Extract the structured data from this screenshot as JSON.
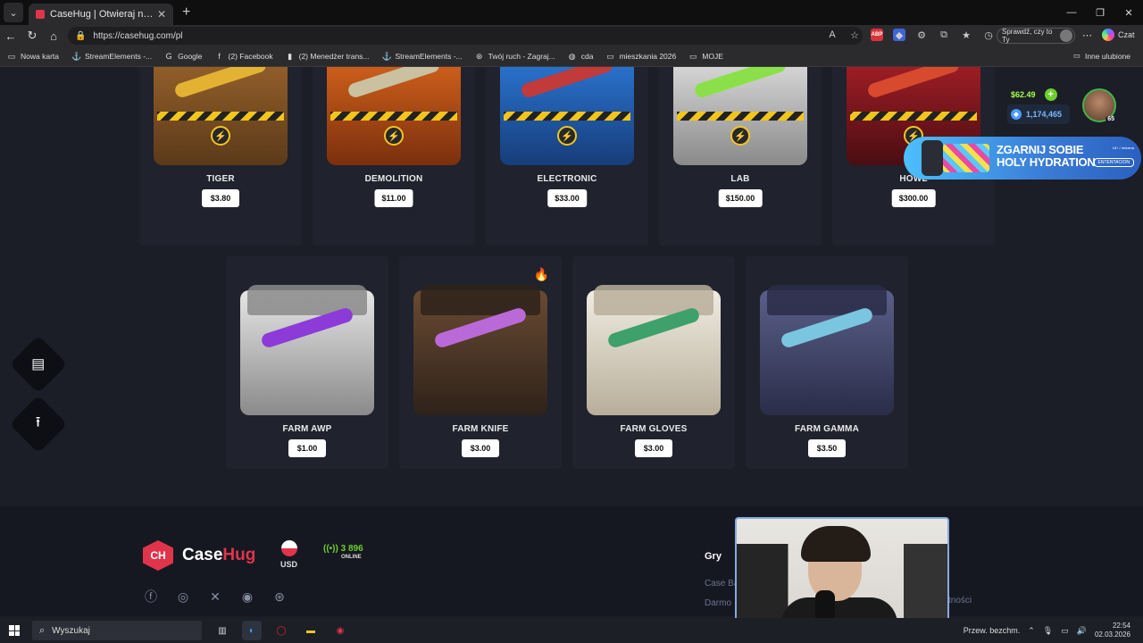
{
  "browser": {
    "tab_title": "CaseHug | Otwieraj najlepsze skrzy",
    "url": "https://casehug.com/pl",
    "profile_label": "Sprawdź, czy to Ty",
    "copilot_label": "Czat",
    "bookmarks": [
      {
        "label": "Nowa karta",
        "icon": "page-icon"
      },
      {
        "label": "StreamElements -...",
        "icon": "streamelements-icon"
      },
      {
        "label": "Google",
        "icon": "google-icon"
      },
      {
        "label": "(2) Facebook",
        "icon": "facebook-icon"
      },
      {
        "label": "(2) Menedżer trans...",
        "icon": "twitch-icon"
      },
      {
        "label": "StreamElements -...",
        "icon": "streamelements-icon"
      },
      {
        "label": "Twój ruch - Zagraj...",
        "icon": "steam-icon"
      },
      {
        "label": "cda",
        "icon": "globe-icon"
      },
      {
        "label": "mieszkania 2026",
        "icon": "folder-icon"
      },
      {
        "label": "MOJE",
        "icon": "folder-icon"
      }
    ],
    "other_favorites": "Inne ulubione"
  },
  "wallet": {
    "balance": "$62.49",
    "coins": "1,174,465",
    "level": "65"
  },
  "ad": {
    "headline_1": "ZGARNIJ SOBIE",
    "headline_2": "HOLY HYDRATION",
    "small": "18+ / reklama",
    "pill": "ENTENTACION"
  },
  "cases_row1": [
    {
      "name": "TIGER",
      "price": "$3.80",
      "color_a": "#a0672d",
      "color_b": "#5b3a1a",
      "item": "#e3b233"
    },
    {
      "name": "DEMOLITION",
      "price": "$11.00",
      "color_a": "#e26a1e",
      "color_b": "#7a2f0e",
      "item": "#c9c1a0"
    },
    {
      "name": "ELECTRONIC",
      "price": "$33.00",
      "color_a": "#2e7fe0",
      "color_b": "#173d7a",
      "item": "#c23a3a"
    },
    {
      "name": "LAB",
      "price": "$150.00",
      "color_a": "#e8e8e8",
      "color_b": "#8a8a8a",
      "item": "#8be04a"
    },
    {
      "name": "HOWL",
      "price": "$300.00",
      "color_a": "#b3212a",
      "color_b": "#4a0d12",
      "item": "#d84a2e"
    }
  ],
  "cases_row2": [
    {
      "name": "FARM AWP",
      "price": "$1.00",
      "color_a": "#e6e6e6",
      "color_b": "#8a8a8a",
      "item": "#8c3ad8"
    },
    {
      "name": "FARM KNIFE",
      "price": "$3.00",
      "color_a": "#6a4a32",
      "color_b": "#2e221a",
      "item": "#b96ad8",
      "hot": true
    },
    {
      "name": "FARM GLOVES",
      "price": "$3.00",
      "color_a": "#f0ece2",
      "color_b": "#b8ae9a",
      "item": "#3ea06a"
    },
    {
      "name": "FARM GAMMA",
      "price": "$3.50",
      "color_a": "#5a5f8a",
      "color_b": "#2a2d48",
      "item": "#7ac6e0"
    }
  ],
  "footer": {
    "brand_a": "Case",
    "brand_b": "Hug",
    "currency": "USD",
    "online_count": "3 896",
    "online_label": "ONLINE",
    "games_heading": "Gry",
    "link_1": "Case Ba",
    "link_2": "Darmo",
    "link_3": "tności"
  },
  "taskbar": {
    "search_placeholder": "Wyszukaj",
    "weather": "Przew. bezchm.",
    "time": "22:54",
    "date": "02.03.2026"
  }
}
